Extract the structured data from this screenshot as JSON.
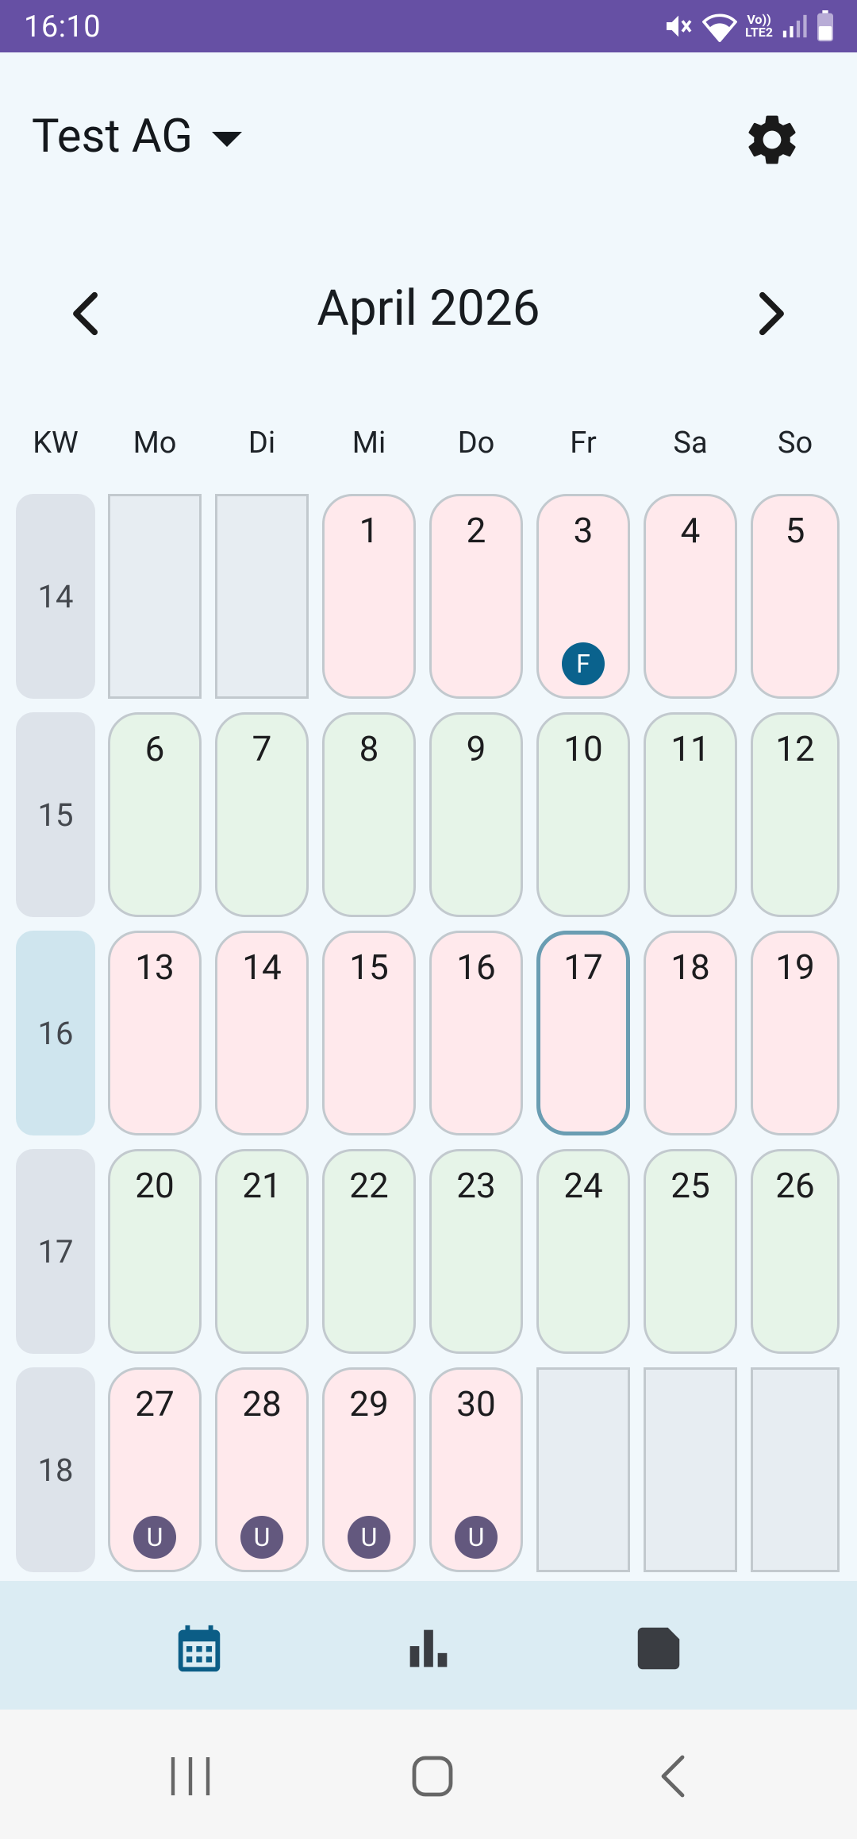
{
  "status_bar": {
    "time": "16:10",
    "net_line1": "Vo))",
    "net_line2": "LTE2",
    "wifi_label": "6",
    "icons": [
      "mute-icon",
      "wifi-icon",
      "signal-icon",
      "battery-icon"
    ]
  },
  "header": {
    "company": "Test AG",
    "company_dropdown_icon": "caret-down-icon",
    "settings_icon": "gear-icon"
  },
  "calendar": {
    "month_label": "April 2026",
    "prev_icon": "chevron-left-icon",
    "next_icon": "chevron-right-icon",
    "weekday_headers": [
      "KW",
      "Mo",
      "Di",
      "Mi",
      "Do",
      "Fr",
      "Sa",
      "So"
    ],
    "weeks": [
      {
        "kw": "14",
        "days": [
          "",
          "",
          "1",
          "2",
          "3",
          "4",
          "5"
        ]
      },
      {
        "kw": "15",
        "days": [
          "6",
          "7",
          "8",
          "9",
          "10",
          "11",
          "12"
        ]
      },
      {
        "kw": "16",
        "days": [
          "13",
          "14",
          "15",
          "16",
          "17",
          "18",
          "19"
        ]
      },
      {
        "kw": "17",
        "days": [
          "20",
          "21",
          "22",
          "23",
          "24",
          "25",
          "26"
        ]
      },
      {
        "kw": "18",
        "days": [
          "27",
          "28",
          "29",
          "30",
          "",
          "",
          ""
        ]
      }
    ],
    "badges": {
      "f": "F",
      "u": "U"
    },
    "colors": {
      "pink_day": "#ffe9ec",
      "green_day": "#e6f4e8",
      "empty_day": "#e7edf2",
      "today_border": "#6a9db2",
      "badge_f": "#0a628d",
      "badge_u": "#63587e"
    },
    "today": "17"
  },
  "bottom_nav": {
    "items": [
      {
        "icon": "calendar-icon",
        "active": true
      },
      {
        "icon": "bar-chart-icon",
        "active": false
      },
      {
        "icon": "note-icon",
        "active": false
      }
    ]
  },
  "system_nav": [
    "recent-apps-icon",
    "home-icon",
    "back-icon"
  ]
}
